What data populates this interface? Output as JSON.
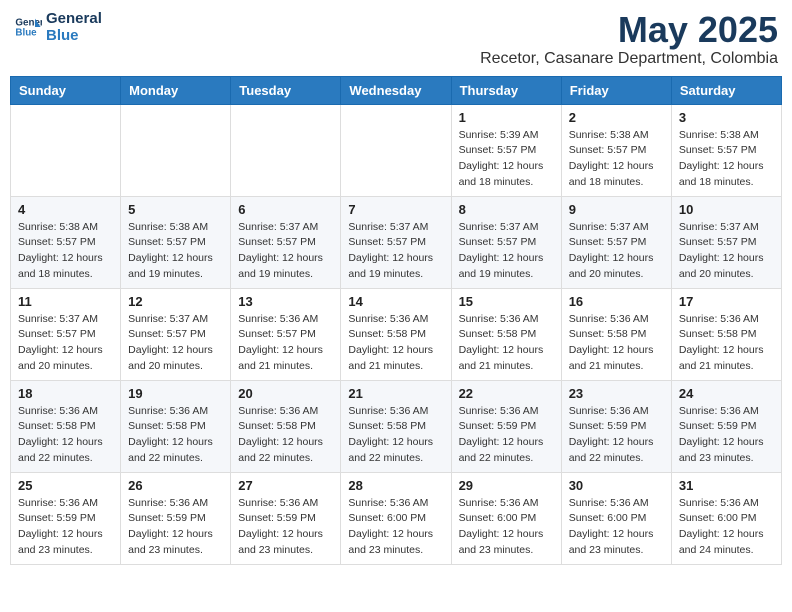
{
  "header": {
    "logo_line1": "General",
    "logo_line2": "Blue",
    "month": "May 2025",
    "location": "Recetor, Casanare Department, Colombia"
  },
  "weekdays": [
    "Sunday",
    "Monday",
    "Tuesday",
    "Wednesday",
    "Thursday",
    "Friday",
    "Saturday"
  ],
  "weeks": [
    [
      {
        "day": "",
        "info": ""
      },
      {
        "day": "",
        "info": ""
      },
      {
        "day": "",
        "info": ""
      },
      {
        "day": "",
        "info": ""
      },
      {
        "day": "1",
        "info": "Sunrise: 5:39 AM\nSunset: 5:57 PM\nDaylight: 12 hours\nand 18 minutes."
      },
      {
        "day": "2",
        "info": "Sunrise: 5:38 AM\nSunset: 5:57 PM\nDaylight: 12 hours\nand 18 minutes."
      },
      {
        "day": "3",
        "info": "Sunrise: 5:38 AM\nSunset: 5:57 PM\nDaylight: 12 hours\nand 18 minutes."
      }
    ],
    [
      {
        "day": "4",
        "info": "Sunrise: 5:38 AM\nSunset: 5:57 PM\nDaylight: 12 hours\nand 18 minutes."
      },
      {
        "day": "5",
        "info": "Sunrise: 5:38 AM\nSunset: 5:57 PM\nDaylight: 12 hours\nand 19 minutes."
      },
      {
        "day": "6",
        "info": "Sunrise: 5:37 AM\nSunset: 5:57 PM\nDaylight: 12 hours\nand 19 minutes."
      },
      {
        "day": "7",
        "info": "Sunrise: 5:37 AM\nSunset: 5:57 PM\nDaylight: 12 hours\nand 19 minutes."
      },
      {
        "day": "8",
        "info": "Sunrise: 5:37 AM\nSunset: 5:57 PM\nDaylight: 12 hours\nand 19 minutes."
      },
      {
        "day": "9",
        "info": "Sunrise: 5:37 AM\nSunset: 5:57 PM\nDaylight: 12 hours\nand 20 minutes."
      },
      {
        "day": "10",
        "info": "Sunrise: 5:37 AM\nSunset: 5:57 PM\nDaylight: 12 hours\nand 20 minutes."
      }
    ],
    [
      {
        "day": "11",
        "info": "Sunrise: 5:37 AM\nSunset: 5:57 PM\nDaylight: 12 hours\nand 20 minutes."
      },
      {
        "day": "12",
        "info": "Sunrise: 5:37 AM\nSunset: 5:57 PM\nDaylight: 12 hours\nand 20 minutes."
      },
      {
        "day": "13",
        "info": "Sunrise: 5:36 AM\nSunset: 5:57 PM\nDaylight: 12 hours\nand 21 minutes."
      },
      {
        "day": "14",
        "info": "Sunrise: 5:36 AM\nSunset: 5:58 PM\nDaylight: 12 hours\nand 21 minutes."
      },
      {
        "day": "15",
        "info": "Sunrise: 5:36 AM\nSunset: 5:58 PM\nDaylight: 12 hours\nand 21 minutes."
      },
      {
        "day": "16",
        "info": "Sunrise: 5:36 AM\nSunset: 5:58 PM\nDaylight: 12 hours\nand 21 minutes."
      },
      {
        "day": "17",
        "info": "Sunrise: 5:36 AM\nSunset: 5:58 PM\nDaylight: 12 hours\nand 21 minutes."
      }
    ],
    [
      {
        "day": "18",
        "info": "Sunrise: 5:36 AM\nSunset: 5:58 PM\nDaylight: 12 hours\nand 22 minutes."
      },
      {
        "day": "19",
        "info": "Sunrise: 5:36 AM\nSunset: 5:58 PM\nDaylight: 12 hours\nand 22 minutes."
      },
      {
        "day": "20",
        "info": "Sunrise: 5:36 AM\nSunset: 5:58 PM\nDaylight: 12 hours\nand 22 minutes."
      },
      {
        "day": "21",
        "info": "Sunrise: 5:36 AM\nSunset: 5:58 PM\nDaylight: 12 hours\nand 22 minutes."
      },
      {
        "day": "22",
        "info": "Sunrise: 5:36 AM\nSunset: 5:59 PM\nDaylight: 12 hours\nand 22 minutes."
      },
      {
        "day": "23",
        "info": "Sunrise: 5:36 AM\nSunset: 5:59 PM\nDaylight: 12 hours\nand 22 minutes."
      },
      {
        "day": "24",
        "info": "Sunrise: 5:36 AM\nSunset: 5:59 PM\nDaylight: 12 hours\nand 23 minutes."
      }
    ],
    [
      {
        "day": "25",
        "info": "Sunrise: 5:36 AM\nSunset: 5:59 PM\nDaylight: 12 hours\nand 23 minutes."
      },
      {
        "day": "26",
        "info": "Sunrise: 5:36 AM\nSunset: 5:59 PM\nDaylight: 12 hours\nand 23 minutes."
      },
      {
        "day": "27",
        "info": "Sunrise: 5:36 AM\nSunset: 5:59 PM\nDaylight: 12 hours\nand 23 minutes."
      },
      {
        "day": "28",
        "info": "Sunrise: 5:36 AM\nSunset: 6:00 PM\nDaylight: 12 hours\nand 23 minutes."
      },
      {
        "day": "29",
        "info": "Sunrise: 5:36 AM\nSunset: 6:00 PM\nDaylight: 12 hours\nand 23 minutes."
      },
      {
        "day": "30",
        "info": "Sunrise: 5:36 AM\nSunset: 6:00 PM\nDaylight: 12 hours\nand 23 minutes."
      },
      {
        "day": "31",
        "info": "Sunrise: 5:36 AM\nSunset: 6:00 PM\nDaylight: 12 hours\nand 24 minutes."
      }
    ]
  ]
}
